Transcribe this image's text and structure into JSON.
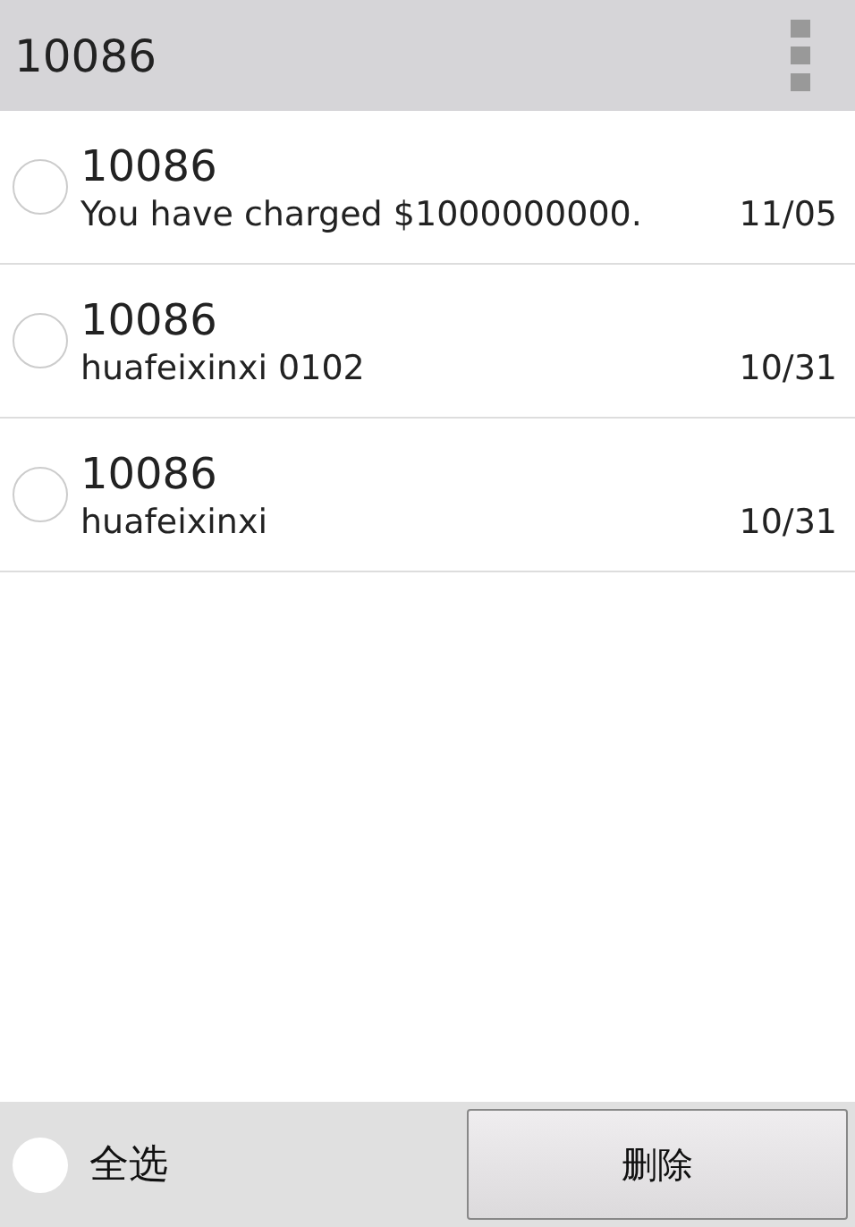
{
  "action_bar": {
    "title": "10086"
  },
  "messages": [
    {
      "sender": "10086",
      "preview": "You have charged $1000000000.",
      "date": "11/05",
      "selected": false
    },
    {
      "sender": "10086",
      "preview": "huafeixinxi 0102",
      "date": "10/31",
      "selected": false
    },
    {
      "sender": "10086",
      "preview": "huafeixinxi",
      "date": "10/31",
      "selected": false
    }
  ],
  "bottom_bar": {
    "select_all": {
      "label": "全选",
      "selected": false
    },
    "delete_button": "删除"
  }
}
